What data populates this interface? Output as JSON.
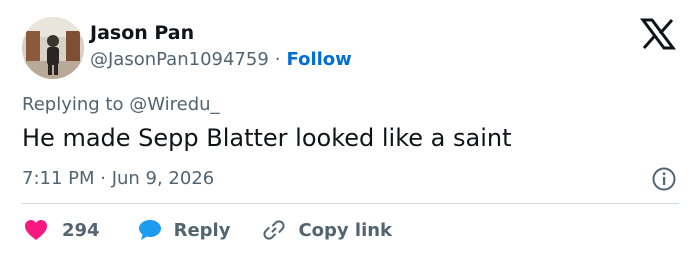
{
  "tweet": {
    "author_name": "Jason Pan",
    "author_handle": "@JasonPan1094759",
    "separator": "·",
    "follow_label": "Follow",
    "replying_prefix": "Replying to",
    "replying_to": "@Wiredu_",
    "text": "He made Sepp Blatter looked like a saint",
    "timestamp": "7:11 PM · Jun 9, 2026"
  },
  "actions": {
    "like_count": "294",
    "reply_label": "Reply",
    "copy_link_label": "Copy link"
  },
  "icons": {
    "logo": "x-logo-icon",
    "info": "info-icon",
    "like": "heart-icon",
    "reply": "speech-bubble-icon",
    "copy": "link-icon"
  },
  "colors": {
    "heart": "#f91880",
    "reply_bubble": "#1d9bf0",
    "follow": "#006fd6",
    "secondary_text": "#536471",
    "primary_text": "#0f1419"
  }
}
